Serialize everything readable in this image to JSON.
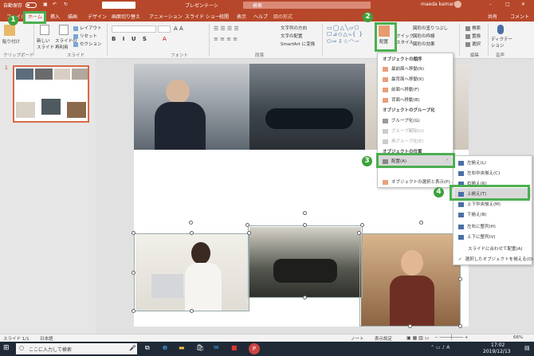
{
  "titlebar": {
    "autosave": "自動保存",
    "doc_title": "プレゼンテーシ",
    "search_label": "検索",
    "user": "maeda kamari"
  },
  "tabs": [
    "ファイル",
    "ホーム",
    "挿入",
    "描画",
    "デザイン",
    "画面切り替え",
    "アニメーション",
    "スライド ショー",
    "校閲",
    "表示",
    "ヘルプ",
    "図の形式"
  ],
  "share": "共有",
  "comment": "コメント",
  "ribbon": {
    "paste": "貼り付け",
    "new_slide": "新しい\nスライド",
    "reuse": "スライドの\n再利用",
    "layout": "レイアウト",
    "reset": "リセット",
    "section": "セクション",
    "text_dir": "文字列の方向",
    "text_align": "文字の配置",
    "smartart": "SmartArt に変換",
    "arrange": "配置",
    "quick_styles": "クイック\nスタイル",
    "shape_fill": "図形の塗りつぶし",
    "shape_outline": "図形の枠線",
    "shape_effects": "図形の効果",
    "find": "検索",
    "replace": "置換",
    "select": "選択",
    "dictate": "ディクテー\nション",
    "groups": {
      "clipboard": "クリップボード",
      "slides": "スライド",
      "font": "フォント",
      "paragraph": "段落",
      "editing": "編集",
      "voice": "音声"
    }
  },
  "arrange_menu": {
    "h_order": "オブジェクトの順序",
    "order": [
      "最前面へ移動(R)",
      "最背面へ移動(K)",
      "前面へ移動(F)",
      "背面へ移動(B)"
    ],
    "h_group": "オブジェクトのグループ化",
    "group": [
      "グループ化(G)",
      "グループ解除(U)",
      "再グループ化(E)"
    ],
    "h_place": "オブジェクトの位置",
    "align": "配置(A)",
    "pane": "オブジェクトの選択と表示(P)..."
  },
  "align_menu": [
    "左揃え(L)",
    "左右中央揃え(C)",
    "右揃え(R)",
    "上揃え(T)",
    "上下中央揃え(M)",
    "下揃え(B)",
    "左右に整列(H)",
    "上下に整列(V)",
    "スライドに合わせて配置(A)",
    "選択したオブジェクトを揃える(O)"
  ],
  "steps": [
    "1",
    "2",
    "3",
    "4"
  ],
  "thumb_number": "1",
  "status": {
    "slide": "スライド 1/1",
    "lang": "日本語",
    "notes": "ノート",
    "display": "表示設定",
    "zoom": "66%"
  },
  "taskbar": {
    "search": "ここに入力して検索",
    "time": "17:02",
    "date": "2019/12/13"
  }
}
